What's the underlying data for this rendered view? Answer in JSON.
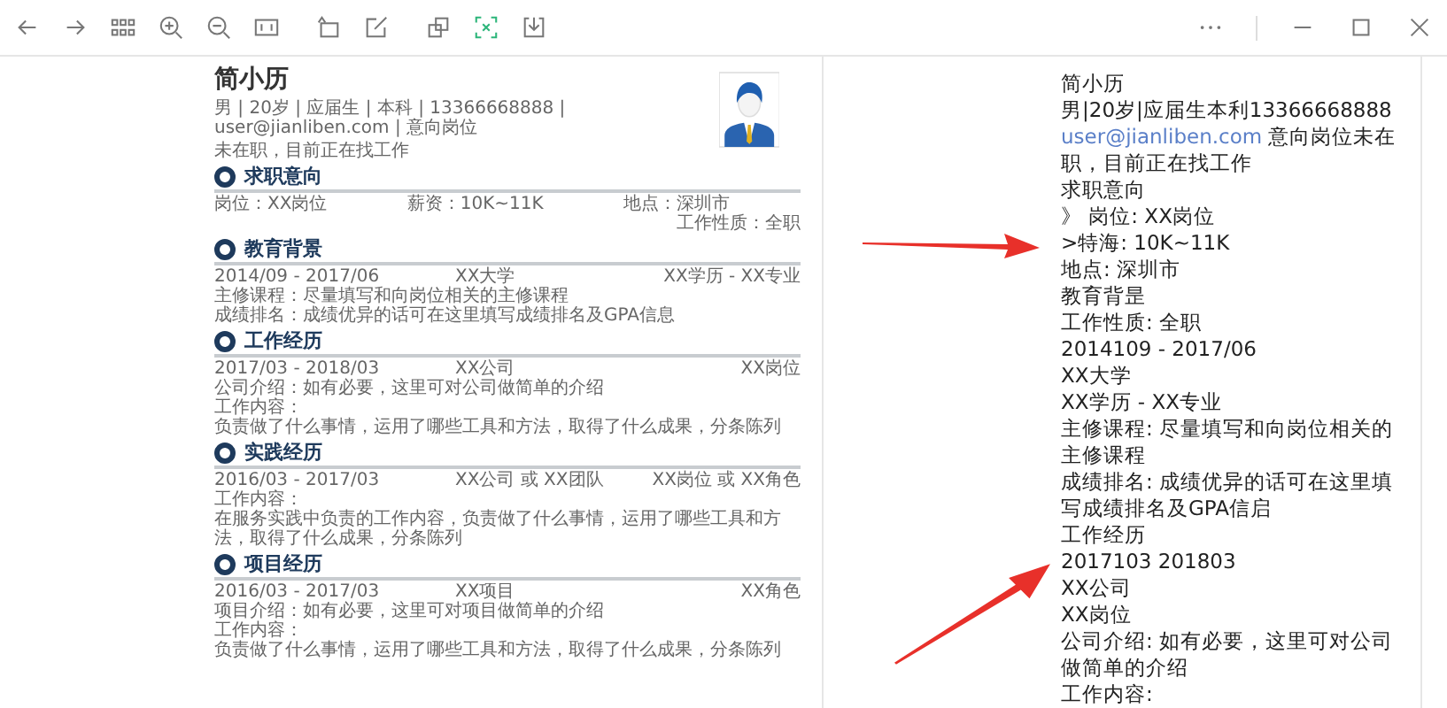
{
  "resume": {
    "name": "简小历",
    "info": "男 | 20岁 | 应届生 | 本科 | 13366668888 | user@jianliben.com | 意向岗位",
    "status": "未在职，目前正在找工作",
    "sections": [
      {
        "title": "求职意向",
        "fields": [
          "岗位：XX岗位",
          "薪资：10K~11K",
          "地点：深圳市"
        ],
        "note": "工作性质：全职"
      },
      {
        "title": "教育背景",
        "header": {
          "date": "2014/09 - 2017/06",
          "org": "XX大学",
          "role": "XX学历 - XX专业"
        },
        "lines": [
          "主修课程：尽量填写和向岗位相关的主修课程",
          "成绩排名：成绩优异的话可在这里填写成绩排名及GPA信息"
        ]
      },
      {
        "title": "工作经历",
        "header": {
          "date": "2017/03 - 2018/03",
          "org": "XX公司",
          "role": "XX岗位"
        },
        "lines": [
          "公司介绍：如有必要，这里可对公司做简单的介绍",
          "工作内容：",
          "负责做了什么事情，运用了哪些工具和方法，取得了什么成果，分条陈列"
        ]
      },
      {
        "title": "实践经历",
        "header": {
          "date": "2016/03 - 2017/03",
          "org": "XX公司 或 XX团队",
          "role": "XX岗位 或 XX角色"
        },
        "lines": [
          "工作内容：",
          "在服务实践中负责的工作内容，负责做了什么事情，运用了哪些工具和方法，取得了什么成果，分条陈列"
        ]
      },
      {
        "title": "项目经历",
        "header": {
          "date": "2016/03 - 2017/03",
          "org": "XX项目",
          "role": "XX角色"
        },
        "lines": [
          "项目介绍：如有必要，这里可对项目做简单的介绍",
          "工作内容：",
          "负责做了什么事情，运用了哪些工具和方法，取得了什么成果，分条陈列"
        ]
      }
    ]
  },
  "extracted_text": [
    {
      "kind": "plain",
      "text": "简小历"
    },
    {
      "kind": "plain",
      "text": "男|20岁|应届生本利13366668888"
    },
    {
      "kind": "link",
      "link": "user@jianliben.com",
      "text": "意向岗位未在职，目前正在找工作"
    },
    {
      "kind": "plain",
      "text": "求职意向"
    },
    {
      "kind": "plain",
      "text": "》 岗位: XX岗位"
    },
    {
      "kind": "plain",
      "text": ">特海: 10K~11K"
    },
    {
      "kind": "plain",
      "text": "地点: 深圳市"
    },
    {
      "kind": "plain",
      "text": "教育背昰"
    },
    {
      "kind": "plain",
      "text": " 工作性质: 全职"
    },
    {
      "kind": "plain",
      "text": "2014109 - 2017/06"
    },
    {
      "kind": "plain",
      "text": "XX大学"
    },
    {
      "kind": "plain",
      "text": "XX学历 - XX专业"
    },
    {
      "kind": "plain",
      "text": "主修课程: 尽量填写和向岗位相关的主修课程"
    },
    {
      "kind": "plain",
      "text": "成绩排名: 成绩优异的话可在这里填写成绩排名及GPA信启"
    },
    {
      "kind": "plain",
      "text": "工作经历"
    },
    {
      "kind": "plain",
      "text": "2017103  201803"
    },
    {
      "kind": "plain",
      "text": "XX公司"
    },
    {
      "kind": "plain",
      "text": "XX岗位"
    },
    {
      "kind": "plain",
      "text": "公司介绍: 如有必要，这里可对公司做简单的介绍"
    },
    {
      "kind": "plain",
      "text": "工作内容:"
    }
  ]
}
